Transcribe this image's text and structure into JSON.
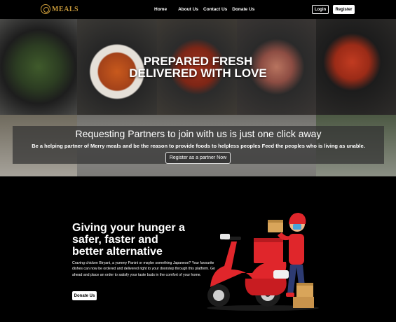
{
  "nav": {
    "logo_text": "MEALS",
    "links": [
      "Home",
      "About Us",
      "Contact Us",
      "Donate Us"
    ],
    "login_label": "Login",
    "register_label": "Register"
  },
  "hero": {
    "headline_line1": "PREPARED FRESH",
    "headline_line2": "DELIVERED WITH LOVE",
    "band_title": "Requesting Partners to join with us is just one click away",
    "band_subtitle": "Be a helping partner of Merry meals and be the reason to provide foods to helpless peoples Feed the peoples who is living as unable.",
    "partner_button": "Register as a partner Now"
  },
  "promo": {
    "heading_line1": "Giving your hunger a",
    "heading_line2": "safer, faster and",
    "heading_line3": "better alternative",
    "paragraph": "Craving chicken Biryani, a yummy Panini or maybe something Japanese? Your favourite dishes can now be ordered and delivered right to your doorstep through this platform. Go ahead and place an order to satisfy your taste buds in the comfort of your home.",
    "donate_button": "Donate Us"
  },
  "colors": {
    "brand_gold": "#c99a3a",
    "scooter_red": "#e0262b",
    "background": "#000000"
  },
  "icons": [
    "logo-icon",
    "delivery-scooter-illustration"
  ]
}
